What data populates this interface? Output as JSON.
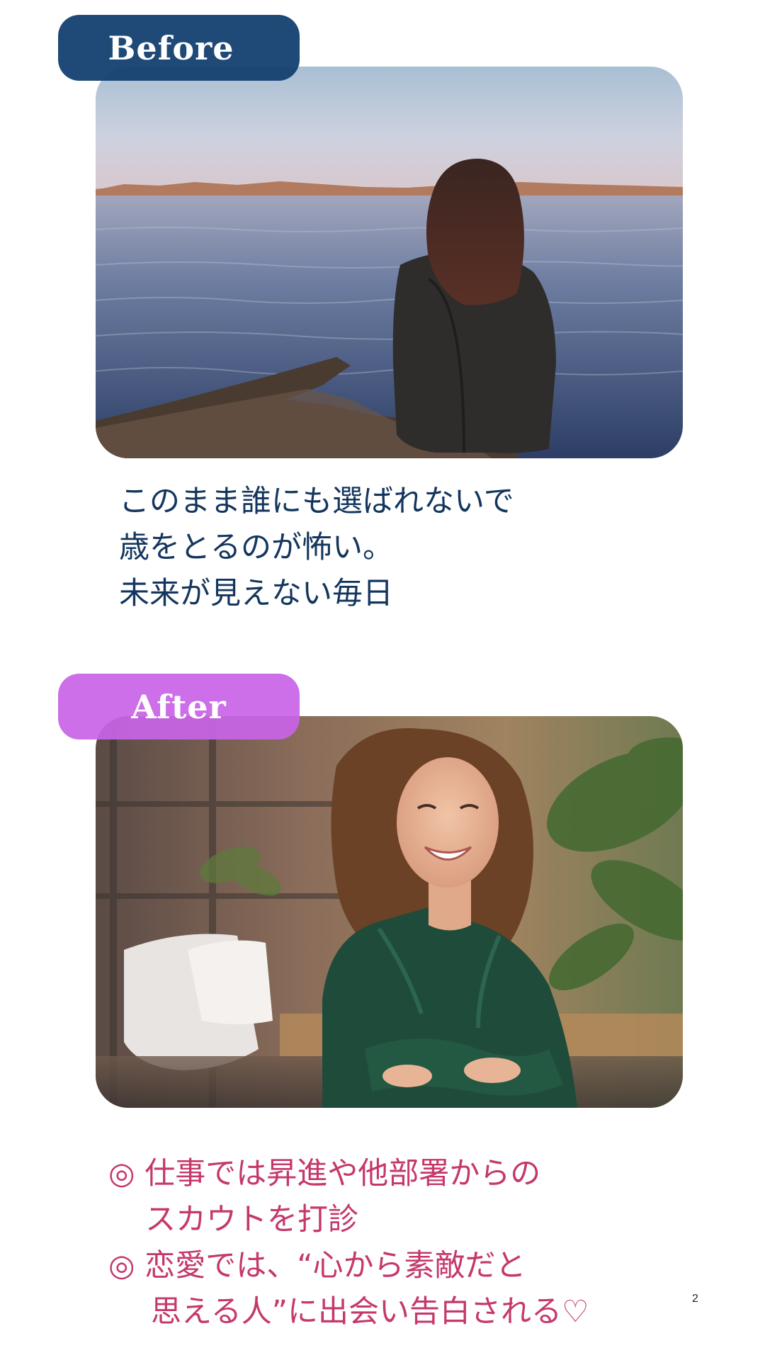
{
  "before": {
    "label": "Before",
    "lines": [
      "このまま誰にも選ばれないで",
      "歳をとるのが怖い。",
      "未来が見えない毎日"
    ]
  },
  "after": {
    "label": "After",
    "lines": [
      "◎ 仕事では昇進や他部署からの",
      "スカウトを打診",
      "◎ 恋愛では、“心から素敵だと",
      "思える人”に出会い告白される♡"
    ]
  },
  "page_number": "2",
  "colors": {
    "before_tag": "#164270",
    "after_tag": "#c864e6",
    "before_text": "#14365e",
    "after_text": "#c5386c"
  }
}
